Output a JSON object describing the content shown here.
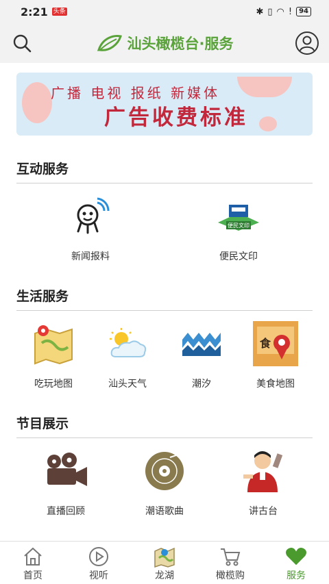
{
  "status_bar": {
    "time": "2:21",
    "badge": "头条",
    "battery": "94"
  },
  "header": {
    "title": "汕头橄榄台·服务"
  },
  "banner": {
    "line1": "广播 电视 报纸 新媒体",
    "line2": "广告收费标准"
  },
  "sections": [
    {
      "title": "互动服务",
      "items": [
        {
          "label": "新闻报料",
          "icon": "news-report-icon"
        },
        {
          "label": "便民文印",
          "icon": "print-icon"
        }
      ]
    },
    {
      "title": "生活服务",
      "items": [
        {
          "label": "吃玩地图",
          "icon": "map-icon"
        },
        {
          "label": "汕头天气",
          "icon": "weather-icon"
        },
        {
          "label": "潮汐",
          "icon": "tide-icon"
        },
        {
          "label": "美食地图",
          "icon": "food-map-icon"
        }
      ]
    },
    {
      "title": "节目展示",
      "items": [
        {
          "label": "直播回顾",
          "icon": "film-camera-icon"
        },
        {
          "label": "潮语歌曲",
          "icon": "vinyl-record-icon"
        },
        {
          "label": "讲古台",
          "icon": "storyteller-icon"
        }
      ]
    }
  ],
  "tabs": [
    {
      "label": "首页",
      "icon": "home-icon"
    },
    {
      "label": "视听",
      "icon": "play-icon"
    },
    {
      "label": "龙湖",
      "icon": "map-pin-icon"
    },
    {
      "label": "橄榄购",
      "icon": "cart-icon"
    },
    {
      "label": "服务",
      "icon": "heart-icon",
      "active": true
    }
  ],
  "colors": {
    "accent": "#5aa33a",
    "banner_text": "#c2283c",
    "banner_bg": "#d8ebf7"
  }
}
